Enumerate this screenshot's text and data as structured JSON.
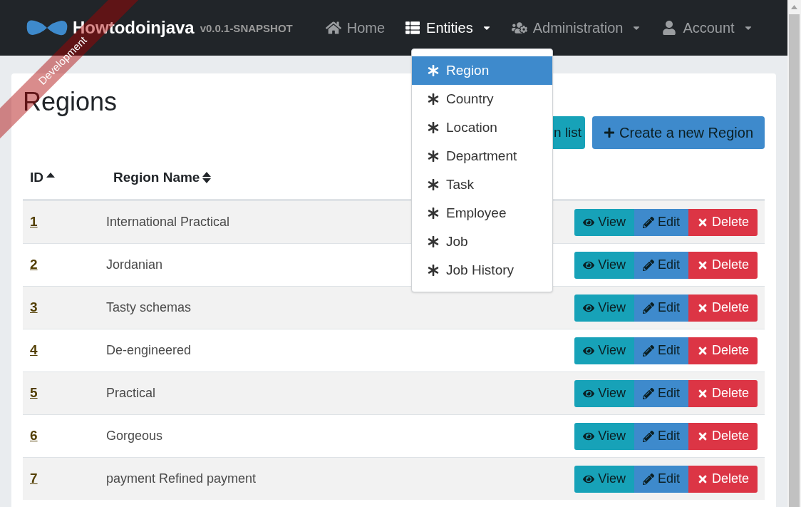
{
  "brand": {
    "name": "Howtodoinjava",
    "version": "v0.0.1-SNAPSHOT"
  },
  "ribbon": "Development",
  "nav": [
    {
      "label": "Home",
      "dropdown": false,
      "selected": false
    },
    {
      "label": "Entities",
      "dropdown": true,
      "selected": true
    },
    {
      "label": "Administration",
      "dropdown": true,
      "selected": false
    },
    {
      "label": "Account",
      "dropdown": true,
      "selected": false
    }
  ],
  "entities_menu": [
    {
      "label": "Region",
      "selected": true
    },
    {
      "label": "Country",
      "selected": false
    },
    {
      "label": "Location",
      "selected": false
    },
    {
      "label": "Department",
      "selected": false
    },
    {
      "label": "Task",
      "selected": false
    },
    {
      "label": "Employee",
      "selected": false
    },
    {
      "label": "Job",
      "selected": false
    },
    {
      "label": "Job History",
      "selected": false
    }
  ],
  "page": {
    "title": "Regions",
    "buttons": [
      {
        "label": "n list",
        "kind": "refresh"
      },
      {
        "label": "Create a new Region",
        "kind": "create"
      }
    ]
  },
  "table": {
    "columns": [
      {
        "label": "ID",
        "sorted": true
      },
      {
        "label": "Region Name",
        "sorted": false
      }
    ],
    "rows": [
      {
        "id": "1",
        "name": "International Practical",
        "actions": [
          "View",
          "Edit",
          "Delete"
        ]
      },
      {
        "id": "2",
        "name": "Jordanian",
        "actions": [
          "View",
          "Edit",
          "Delete"
        ]
      },
      {
        "id": "3",
        "name": "Tasty schemas",
        "actions": [
          "View",
          "Edit",
          "Delete"
        ]
      },
      {
        "id": "4",
        "name": "De-engineered",
        "actions": [
          "View",
          "Edit",
          "Delete"
        ]
      },
      {
        "id": "5",
        "name": "Practical",
        "actions": [
          "View",
          "Edit",
          "Delete"
        ]
      },
      {
        "id": "6",
        "name": "Gorgeous",
        "actions": [
          "View",
          "Edit",
          "Delete"
        ]
      },
      {
        "id": "7",
        "name": "payment Refined payment",
        "actions": [
          "View",
          "Edit",
          "Delete"
        ]
      }
    ]
  }
}
